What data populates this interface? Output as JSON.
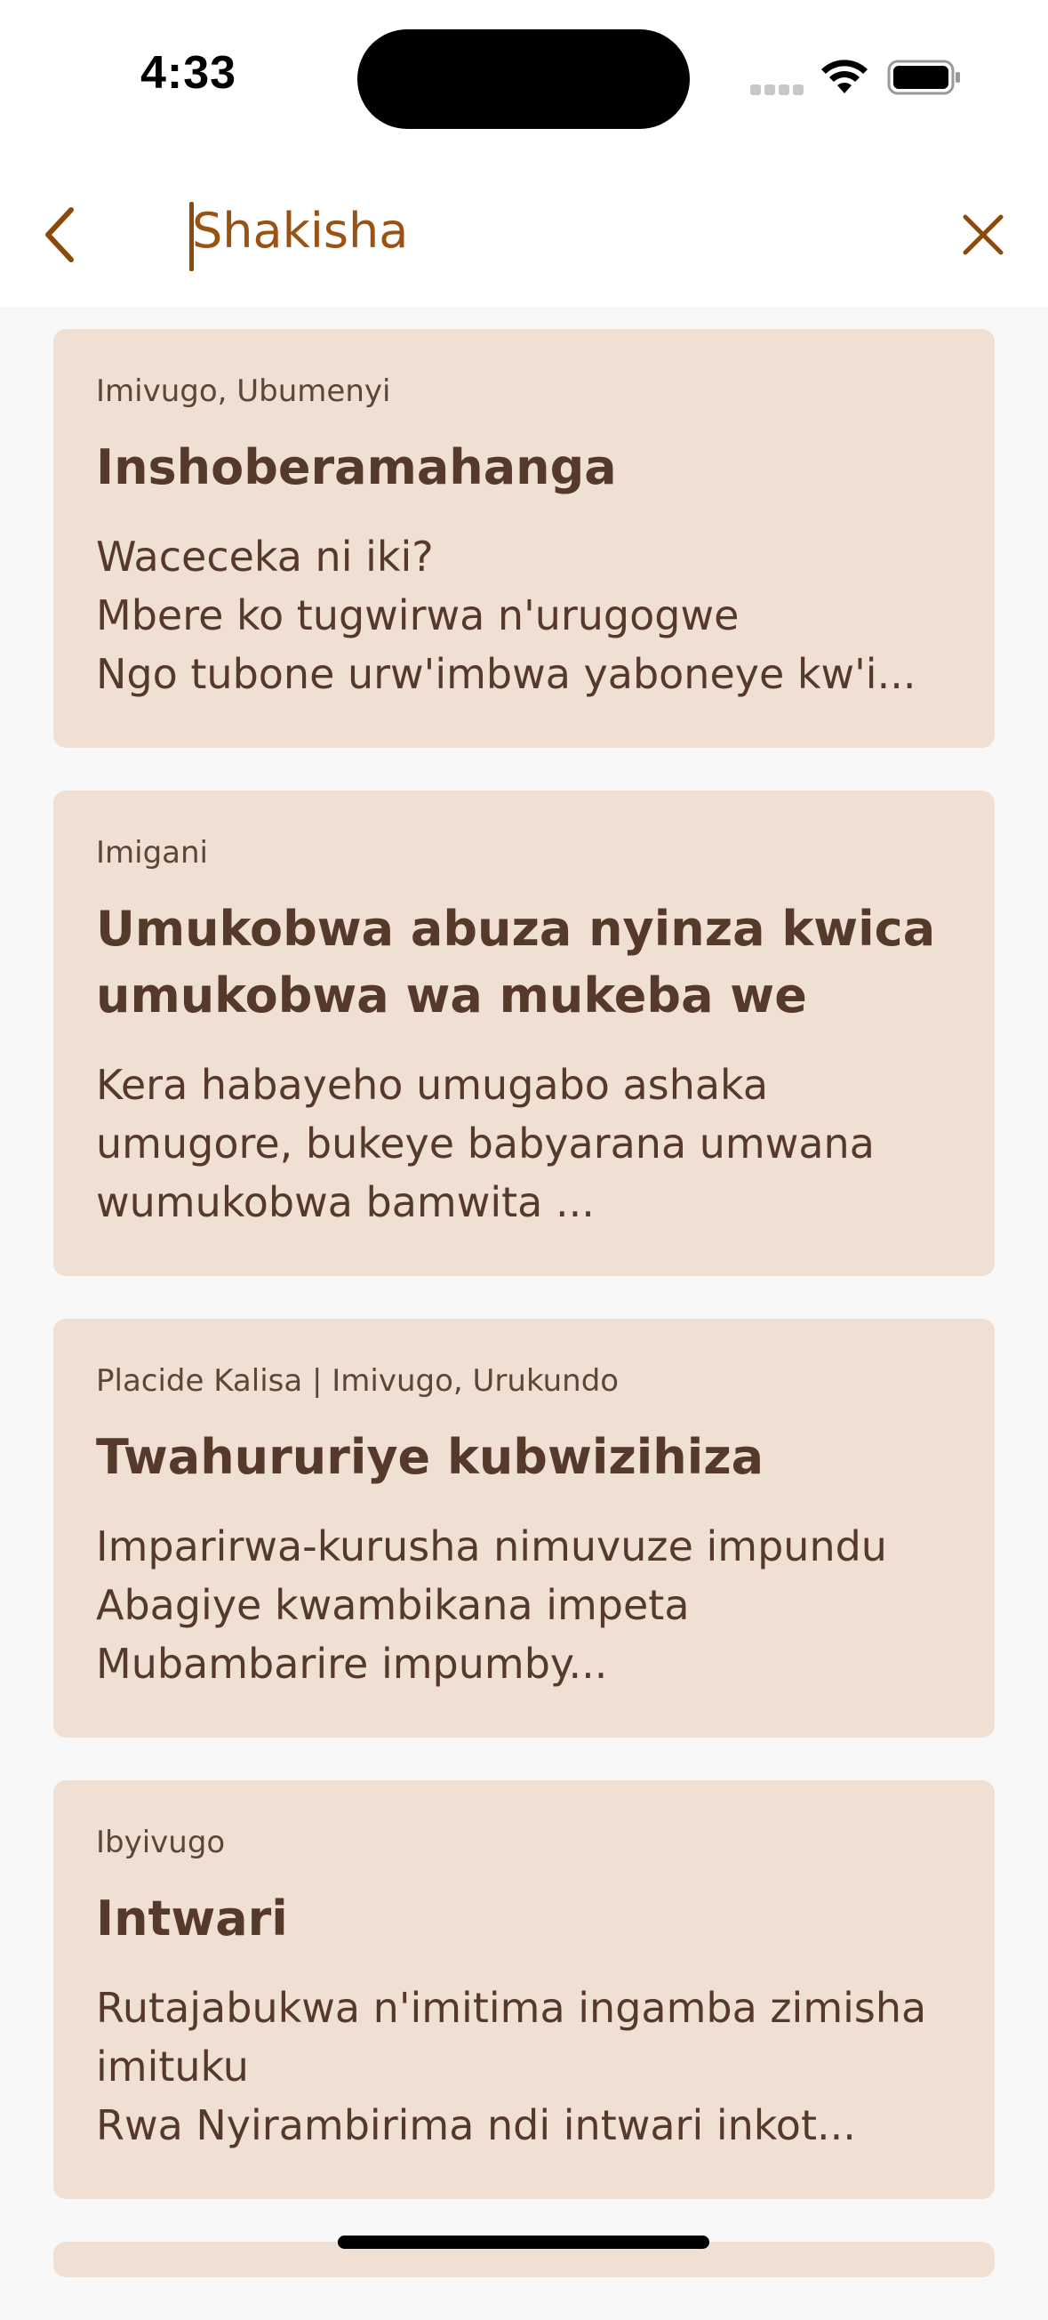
{
  "status_bar": {
    "time": "4:33"
  },
  "header": {
    "search_placeholder": "Shakisha",
    "accent_color": "#8b4a0c"
  },
  "results": [
    {
      "meta": "Imivugo, Ubumenyi",
      "title": "Inshoberamahanga",
      "excerpt": "Waceceka ni iki?\nMbere ko tugwirwa n'urugogwe\nNgo tubone urw'imbwa yaboneye kw'i..."
    },
    {
      "meta": "Imigani",
      "title": "Umukobwa abuza nyinza kwica umukobwa wa mukeba we",
      "excerpt": "Kera habayeho umugabo ashaka umugore, bukeye babyarana umwana wumukobwa bamwita ..."
    },
    {
      "meta": "Placide Kalisa | Imivugo, Urukundo",
      "title": "Twahururiye kubwizihiza",
      "excerpt": "Imparirwa-kurusha nimuvuze impundu\nAbagiye kwambikana impeta\nMubambarire impumby..."
    },
    {
      "meta": "Ibyivugo",
      "title": "Intwari",
      "excerpt": "Rutajabukwa n'imitima ingamba zimisha imituku\nRwa Nyirambirima ndi intwari inkot..."
    }
  ],
  "colors": {
    "card_background": "#f0dfd3",
    "page_background": "#f8f8f8",
    "text": "#55392a"
  }
}
